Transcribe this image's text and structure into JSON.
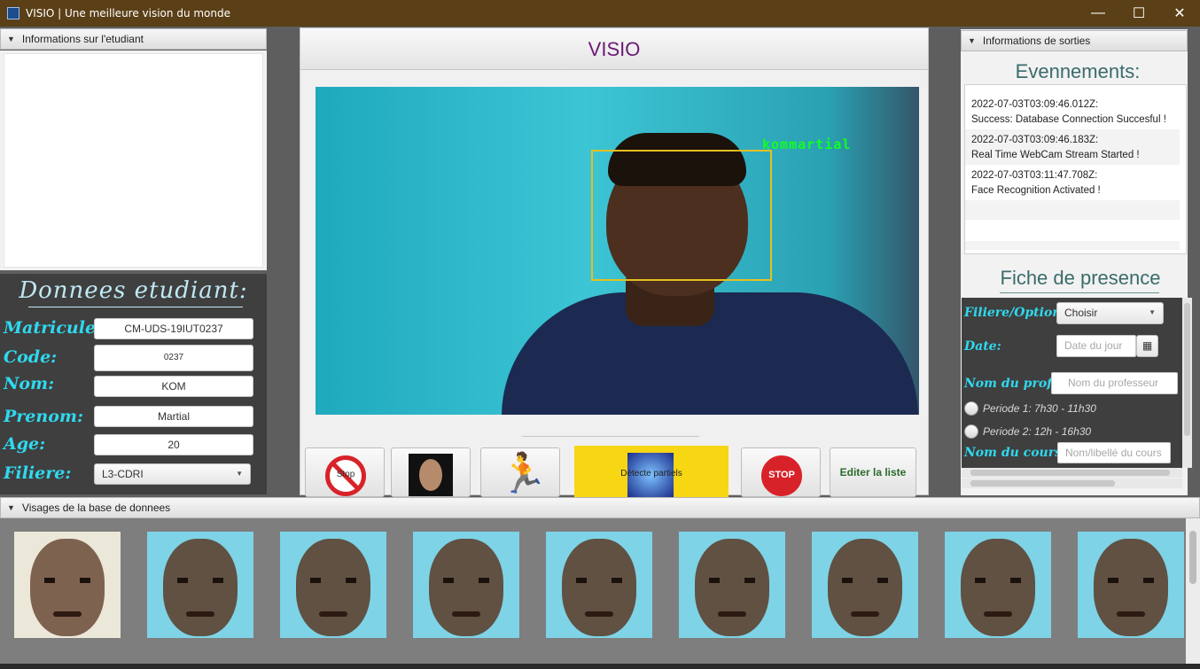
{
  "window": {
    "title": "VISIO | Une meilleure vision du monde",
    "minimize": "—",
    "maximize": "☐",
    "close": "✕"
  },
  "left": {
    "info_header": "Informations sur l'etudiant",
    "donnees_title": "Donnees etudiant:",
    "fields": [
      {
        "label": "Matricule:",
        "value": "CM-UDS-19IUT0237"
      },
      {
        "label": "Code:",
        "value": "0237"
      },
      {
        "label": "Nom:",
        "value": "KOM"
      },
      {
        "label": "Prenom:",
        "value": "Martial"
      },
      {
        "label": "Age:",
        "value": "20"
      },
      {
        "label": "Filiere:",
        "value": "L3-CDRI"
      }
    ]
  },
  "center": {
    "title": "VISIO",
    "detected_name": "kommartial",
    "buttons": {
      "stop": "Stop",
      "stop_red": "STOP",
      "detect_label": "Détecte partiels",
      "edit_list": "Editer la liste"
    }
  },
  "right": {
    "output_header": "Informations de sorties",
    "events_title": "Evennements:",
    "events": [
      {
        "time": "2022-07-03T03:09:46.012Z:",
        "message": "Success: Database Connection Succesful !"
      },
      {
        "time": "2022-07-03T03:09:46.183Z:",
        "message": " Real Time WebCam Stream Started !"
      },
      {
        "time": "2022-07-03T03:11:47.708Z:",
        "message": "Face Recognition Activated !"
      }
    ],
    "fiche_title": "Fiche de presence",
    "filiere_label": "Filiere/Option:",
    "filiere_value": "Choisir",
    "date_label": "Date:",
    "date_placeholder": "Date du jour",
    "prof_label": "Nom du prof:",
    "prof_placeholder": "Nom du professeur",
    "periode1": "Periode 1: 7h30 - 11h30",
    "periode2": "Periode 2: 12h - 16h30",
    "cours_label": "Nom du cours:",
    "cours_placeholder": "Nom/libellé du cours"
  },
  "bottom": {
    "header": "Visages de la base de donnees",
    "face_count": 9
  },
  "colors": {
    "titlebar": "#5b3f17",
    "accent_cyan": "#2fd9ef",
    "dark_panel": "#3f3f3f",
    "visio_title": "#6b1a76",
    "detect_box": "#e5c021",
    "detect_text": "#11ff22",
    "yellow_button": "#f7d614"
  }
}
